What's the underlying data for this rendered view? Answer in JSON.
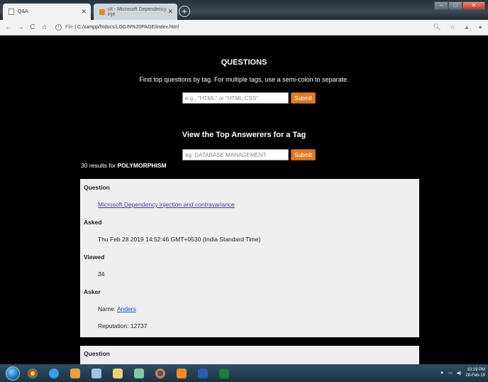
{
  "browser": {
    "tabs": [
      {
        "title": "Q&A",
        "active": true
      },
      {
        "title": "c# - Microsoft Dependency inje",
        "active": false
      }
    ],
    "url_prefix": "File",
    "url": "C:/xampp/htdocs/LOGIN%20PAGE/index.html"
  },
  "questions_section": {
    "heading": "QUESTIONS",
    "instructions": "Find top questions by tag. For multiple tags, use a semi-colon to separate.",
    "input_placeholder": "e.g., \"HTML\" or \"HTML;CSS\"",
    "submit_label": "Submit"
  },
  "answerers_section": {
    "heading": "View the Top Answerers for a Tag",
    "input_placeholder": "eg: DATABASE MANAGEMENT",
    "submit_label": "Submit"
  },
  "results": {
    "count_text": "30 results for",
    "tag": "POLYMORPHISM"
  },
  "card": {
    "question_label": "Question",
    "question_title": "Microsoft Dependency injection and contravariance",
    "asked_label": "Asked",
    "asked_value": "Thu Feb 28 2019 14:52:46 GMT+0530 (India Standard Time)",
    "viewed_label": "Viewed",
    "viewed_value": "34",
    "asker_label": "Asker",
    "name_prefix": "Name:",
    "asker_name": "Anders",
    "reputation": "Reputation: 12737"
  },
  "card2": {
    "question_label": "Question"
  },
  "taskbar": {
    "time": "10:19 PM",
    "date": "28-Feb-19"
  },
  "colors": {
    "accent": "#e07b24",
    "page_bg": "#000000",
    "card_bg": "#efefef",
    "link": "#4a3aa8"
  }
}
